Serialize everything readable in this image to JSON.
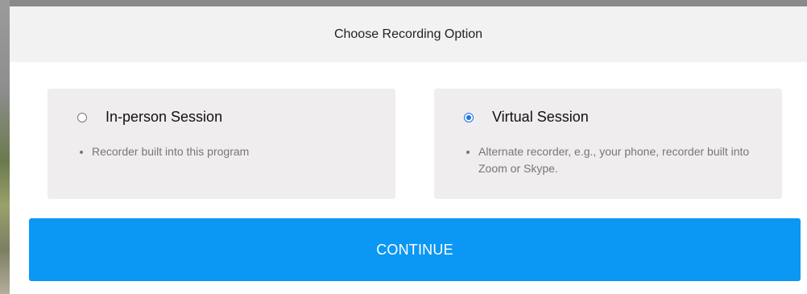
{
  "dialog": {
    "title": "Choose Recording Option",
    "options": [
      {
        "label": "In-person Session",
        "selected": false,
        "bullets": [
          "Recorder built into this program"
        ]
      },
      {
        "label": "Virtual Session",
        "selected": true,
        "bullets": [
          "Alternate recorder, e.g., your phone, recorder built into Zoom or Skype."
        ]
      }
    ],
    "continue_label": "CONTINUE"
  },
  "colors": {
    "accent": "#0b97f4",
    "header_bg": "#f2f2f2",
    "card_bg": "#efeded",
    "radio_selected": "#1a73e8"
  }
}
